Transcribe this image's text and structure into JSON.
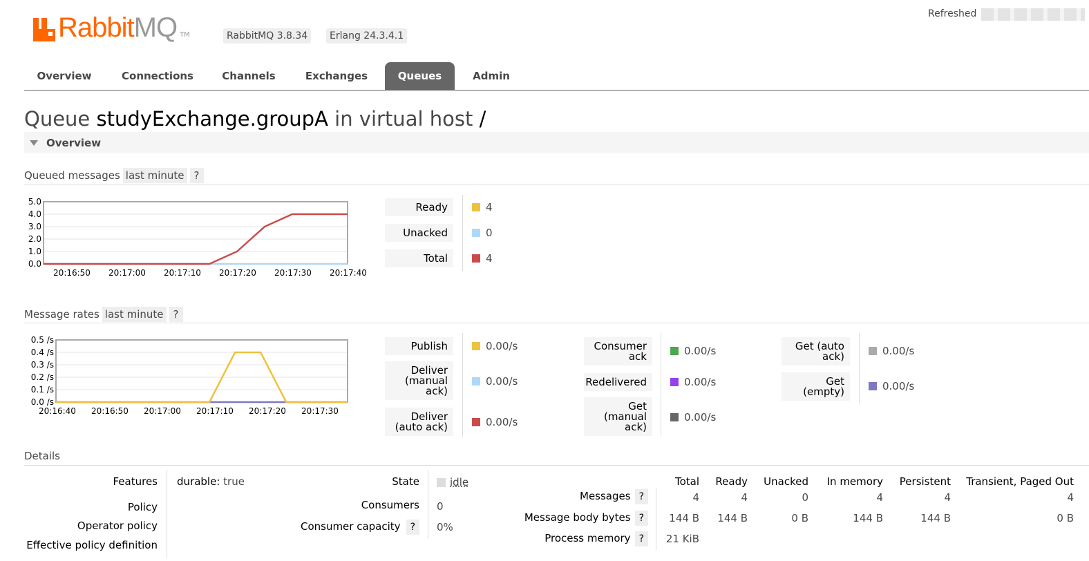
{
  "header": {
    "logo_rabbit": "Rabbit",
    "logo_mq": "MQ",
    "logo_tm": "TM",
    "rabbitmq_version": "RabbitMQ 3.8.34",
    "erlang_version": "Erlang 24.3.4.1",
    "refreshed_label": "Refreshed"
  },
  "tabs": [
    {
      "label": "Overview",
      "active": false
    },
    {
      "label": "Connections",
      "active": false
    },
    {
      "label": "Channels",
      "active": false
    },
    {
      "label": "Exchanges",
      "active": false
    },
    {
      "label": "Queues",
      "active": true
    },
    {
      "label": "Admin",
      "active": false
    }
  ],
  "title": {
    "prefix": "Queue",
    "queue_name": "studyExchange.groupA",
    "middle": "in virtual host",
    "vhost": "/"
  },
  "overview_section": {
    "label": "Overview"
  },
  "queued_messages": {
    "heading": "Queued messages",
    "range": "last minute",
    "help": "?",
    "legend": [
      {
        "label": "Ready",
        "value": "4",
        "color": "#edc240"
      },
      {
        "label": "Unacked",
        "value": "0",
        "color": "#afd8f8"
      },
      {
        "label": "Total",
        "value": "4",
        "color": "#cb4b4b"
      }
    ]
  },
  "message_rates": {
    "heading": "Message rates",
    "range": "last minute",
    "help": "?",
    "legend_col1": [
      {
        "label": "Publish",
        "value": "0.00/s",
        "color": "#edc240"
      },
      {
        "label": "Deliver (manual ack)",
        "value": "0.00/s",
        "color": "#afd8f8"
      },
      {
        "label": "Deliver (auto ack)",
        "value": "0.00/s",
        "color": "#cb4b4b"
      }
    ],
    "legend_col2": [
      {
        "label": "Consumer ack",
        "value": "0.00/s",
        "color": "#4da74d"
      },
      {
        "label": "Redelivered",
        "value": "0.00/s",
        "color": "#9440ed"
      },
      {
        "label": "Get (manual ack)",
        "value": "0.00/s",
        "color": "#666666"
      }
    ],
    "legend_col3": [
      {
        "label": "Get (auto ack)",
        "value": "0.00/s",
        "color": "#aaaaaa"
      },
      {
        "label": "Get (empty)",
        "value": "0.00/s",
        "color": "#7c79c0"
      }
    ]
  },
  "chart_data": [
    {
      "type": "line",
      "title": "Queued messages",
      "x": [
        "20:16:50",
        "20:17:00",
        "20:17:10",
        "20:17:20",
        "20:17:30",
        "20:17:40"
      ],
      "ylim": [
        0,
        5
      ],
      "y_ticks": [
        "0.0",
        "1.0",
        "2.0",
        "3.0",
        "4.0",
        "5.0"
      ],
      "x_seconds_from_start": [
        0,
        5,
        10,
        15,
        20,
        25,
        30,
        35,
        40,
        45,
        50,
        55
      ],
      "series": [
        {
          "name": "Total",
          "color": "#cb4b4b",
          "values": [
            0,
            0,
            0,
            0,
            0,
            0,
            0,
            1,
            3,
            4,
            4,
            4
          ]
        },
        {
          "name": "Unacked",
          "color": "#afd8f8",
          "values": [
            0,
            0,
            0,
            0,
            0,
            0,
            0,
            0,
            0,
            0,
            0,
            0
          ]
        }
      ]
    },
    {
      "type": "line",
      "title": "Message rates",
      "x": [
        "20:16:40",
        "20:16:50",
        "20:17:00",
        "20:17:10",
        "20:17:20",
        "20:17:30"
      ],
      "ylim": [
        0,
        0.5
      ],
      "y_ticks": [
        "0.0 /s",
        "0.1 /s",
        "0.2 /s",
        "0.3 /s",
        "0.4 /s",
        "0.5 /s"
      ],
      "x_seconds_from_start": [
        0,
        5,
        10,
        15,
        20,
        25,
        30,
        35,
        40,
        45,
        50,
        55,
        57
      ],
      "series": [
        {
          "name": "Publish",
          "color": "#edc240",
          "values": [
            0,
            0,
            0,
            0,
            0,
            0,
            0,
            0.4,
            0.4,
            0,
            0,
            0,
            0
          ]
        },
        {
          "name": "Get (empty)",
          "color": "#7c79c0",
          "values": [
            0,
            0,
            0,
            0,
            0,
            0,
            0,
            0,
            0,
            0,
            0,
            0,
            0
          ]
        }
      ]
    }
  ],
  "details": {
    "heading": "Details",
    "features_label": "Features",
    "features_key": "durable:",
    "features_value": "true",
    "policy_label": "Policy",
    "operator_policy_label": "Operator policy",
    "effective_policy_label": "Effective policy definition",
    "state_label": "State",
    "state_value": "idle",
    "consumers_label": "Consumers",
    "consumers_value": "0",
    "consumer_capacity_label": "Consumer capacity",
    "consumer_capacity_help": "?",
    "consumer_capacity_value": "0%",
    "table": {
      "columns": [
        "Total",
        "Ready",
        "Unacked",
        "In memory",
        "Persistent",
        "Transient, Paged Out"
      ],
      "rows": [
        {
          "label": "Messages",
          "help": "?",
          "cells": [
            "4",
            "4",
            "0",
            "4",
            "4",
            "4"
          ]
        },
        {
          "label": "Message body bytes",
          "help": "?",
          "cells": [
            "144 B",
            "144 B",
            "0 B",
            "144 B",
            "144 B",
            "0 B"
          ]
        },
        {
          "label": "Process memory",
          "help": "?",
          "cells": [
            "21 KiB"
          ]
        }
      ]
    }
  }
}
